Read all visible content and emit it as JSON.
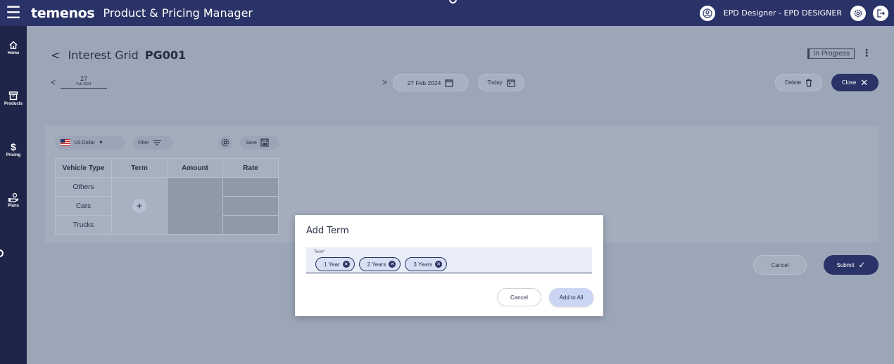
{
  "app": {
    "brand": "temenos",
    "title": "Product & Pricing Manager",
    "user": "EPD Designer - EPD DESIGNER",
    "colors": {
      "primary": "#2a3367",
      "sidebar": "#1e2548"
    }
  },
  "sidebar": {
    "items": [
      {
        "label": "Home",
        "icon": "home-icon"
      },
      {
        "label": "Products",
        "icon": "archive-icon"
      },
      {
        "label": "Pricing",
        "icon": "dollar-icon"
      },
      {
        "label": "Plans",
        "icon": "plans-icon"
      }
    ]
  },
  "page": {
    "back": "<",
    "heading": "Interest Grid",
    "code": "PG001",
    "status": "In Progress",
    "more": "⋮"
  },
  "date_nav": {
    "prev": "<",
    "next": ">",
    "tab_day": "27",
    "tab_month": "Feb-2024",
    "picker_value": "27 Feb 2024",
    "today_label": "Today"
  },
  "actions": {
    "delete_label": "Delete",
    "close_label": "Close"
  },
  "grid": {
    "currency": "US Dollar",
    "filter_label": "Filter",
    "save_label": "Save",
    "columns": [
      "Vehicle Type",
      "Term",
      "Amount",
      "Rate"
    ],
    "rows": [
      "Others",
      "Cars",
      "Trucks"
    ],
    "add_term_symbol": "+"
  },
  "footer": {
    "cancel_label": "Cancel",
    "submit_label": "Submit"
  },
  "modal": {
    "title": "Add Term",
    "field_label": "Term*",
    "chips": [
      "1 Year",
      "2 Years",
      "3 Years"
    ],
    "cancel_label": "Cancel",
    "add_label": "Add to All"
  }
}
